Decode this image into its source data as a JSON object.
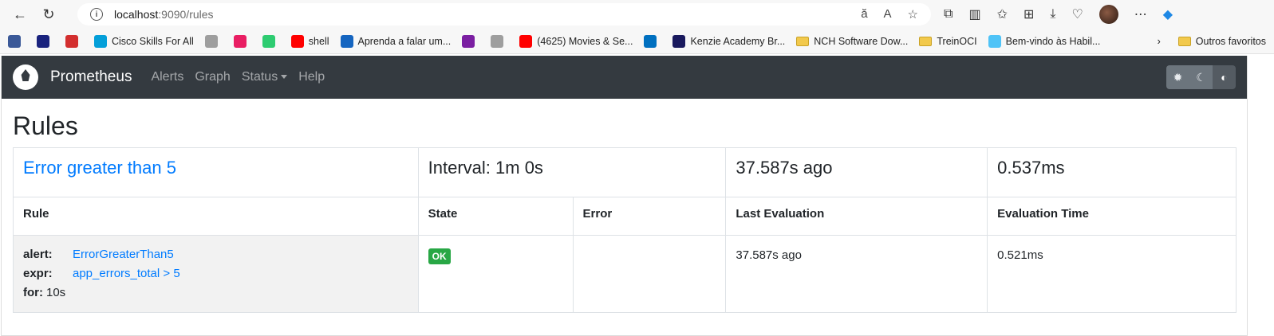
{
  "browser": {
    "url_host": "localhost",
    "url_path": ":9090/rules",
    "bookmarks": [
      {
        "label": "",
        "color": "#3b5998"
      },
      {
        "label": "",
        "color": "#1a237e"
      },
      {
        "label": "",
        "color": "#d32f2f"
      },
      {
        "label": "Cisco Skills For All",
        "color": "#049fd9"
      },
      {
        "label": "",
        "color": "#9e9e9e"
      },
      {
        "label": "",
        "color": "#e91e63"
      },
      {
        "label": "",
        "color": "#2ecc71"
      },
      {
        "label": "shell",
        "color": "#ff0000"
      },
      {
        "label": "Aprenda a falar um...",
        "color": "#1565c0"
      },
      {
        "label": "",
        "color": "#7b1fa2"
      },
      {
        "label": "",
        "color": "#9e9e9e"
      },
      {
        "label": "(4625) Movies & Se...",
        "color": "#ff0000"
      },
      {
        "label": "",
        "color": "#0070c0"
      },
      {
        "label": "Kenzie Academy Br...",
        "color": "#1a1a5e"
      },
      {
        "label": "NCH Software Dow...",
        "color": "folder"
      },
      {
        "label": "TreinOCI",
        "color": "folder"
      },
      {
        "label": "Bem-vindo às Habil...",
        "color": "#4fc3f7"
      }
    ],
    "other_favorites": "Outros favoritos"
  },
  "navbar": {
    "brand": "Prometheus",
    "links": {
      "alerts": "Alerts",
      "graph": "Graph",
      "status": "Status",
      "help": "Help"
    }
  },
  "page": {
    "title": "Rules"
  },
  "group": {
    "name": "Error greater than 5",
    "interval": "Interval: 1m 0s",
    "last_eval": "37.587s ago",
    "eval_time": "0.537ms"
  },
  "table": {
    "headers": {
      "rule": "Rule",
      "state": "State",
      "error": "Error",
      "last_eval": "Last Evaluation",
      "eval_time": "Evaluation Time"
    }
  },
  "rule": {
    "alert_key": "alert:",
    "alert_value": "ErrorGreaterThan5",
    "expr_key": "expr:",
    "expr_value": "app_errors_total > 5",
    "for_key": "for:",
    "for_value": "10s",
    "state": "OK",
    "error": "",
    "last_eval": "37.587s ago",
    "eval_time": "0.521ms"
  },
  "colors": {
    "navbar": "#343a40",
    "link": "#007bff",
    "ok_badge": "#28a745"
  }
}
